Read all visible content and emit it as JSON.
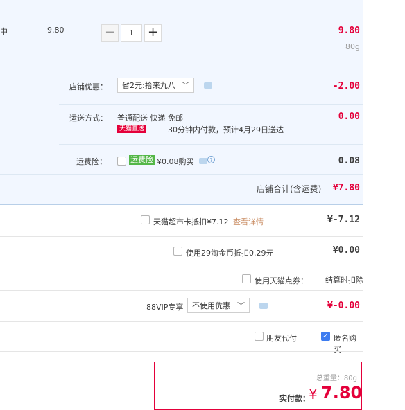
{
  "item": {
    "name_fragment": "中",
    "unit_price": "9.80",
    "quantity": "1",
    "subtotal": "9.80",
    "weight": "80g"
  },
  "store_promo": {
    "label": "店铺优惠：",
    "selected": "省2元:拾来九八",
    "amount": "-2.00"
  },
  "shipping": {
    "label": "运送方式：",
    "method": "普通配送 快递 免邮",
    "badge": "天猫直送",
    "note": "30分钟内付款，预计4月29日送达",
    "amount": "0.00"
  },
  "freight_insurance": {
    "label": "运费险：",
    "tag": "运费险",
    "text": "¥0.08购买",
    "amount": "0.08"
  },
  "store_total": {
    "label": "店铺合计(含运费)",
    "amount": "¥7.80"
  },
  "discounts": {
    "supermarket_card": {
      "label": "天猫超市卡抵扣¥7.12",
      "link": "查看详情",
      "amount": "¥-7.12"
    },
    "taojinbi": {
      "label": "使用29淘金币抵扣0.29元",
      "amount": "¥0.00"
    },
    "tmall_points": {
      "label": "使用天猫点券：",
      "amount": "结算时扣除"
    },
    "vip88": {
      "label": "88VIP专享",
      "selected": "不使用优惠",
      "amount": "¥-0.00"
    }
  },
  "options": {
    "friend_pay": {
      "label": "朋友代付",
      "checked": false
    },
    "anonymous": {
      "label": "匿名购买",
      "checked": true
    }
  },
  "summary": {
    "weight_label": "总重量：80g",
    "pay_label": "实付款：",
    "currency": "¥",
    "amount": "7.80"
  },
  "colors": {
    "accent": "#e4003a",
    "panel": "#f2f7ff",
    "check": "#3d7cf0",
    "tag": "#54b748"
  }
}
